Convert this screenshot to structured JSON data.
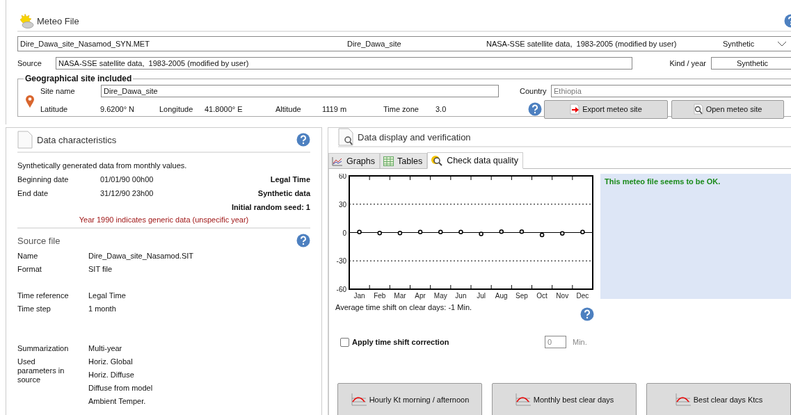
{
  "header": {
    "title": "Meteo File"
  },
  "file_select": {
    "columns": [
      "Dire_Dawa_site_Nasamod_SYN.MET",
      "Dire_Dawa_site",
      "NASA-SSE satellite data,  1983-2005 (modified by user)",
      "Synthetic"
    ]
  },
  "source": {
    "label": "Source",
    "value": "NASA-SSE satellite data,  1983-2005 (modified by user)"
  },
  "kind_year": {
    "label": "Kind / year",
    "value": "Synthetic"
  },
  "site_group": {
    "legend": "Geographical site included",
    "site_name_label": "Site name",
    "site_name": "Dire_Dawa_site",
    "country_label": "Country",
    "country": "Ethiopia",
    "coords": [
      {
        "label": "Latitude",
        "value": "9.6200° N"
      },
      {
        "label": "Longitude",
        "value": "41.8000° E"
      },
      {
        "label": "Altitude",
        "value": "1119 m"
      },
      {
        "label": "Time zone",
        "value": "3.0"
      }
    ],
    "buttons": [
      {
        "label": "Export meteo site",
        "kind": "export"
      },
      {
        "label": "Open meteo site",
        "kind": "open"
      }
    ]
  },
  "data_characteristics": {
    "title": "Data characteristics",
    "intro": "Synthetically generated data from monthly values.",
    "rows": [
      {
        "label": "Beginning date",
        "value": "01/01/90 00h00",
        "note": "Legal Time"
      },
      {
        "label": "End date",
        "value": "31/12/90 23h00",
        "note": "Synthetic data"
      },
      {
        "note": "Initial random seed: 1"
      }
    ],
    "warning": "Year 1990 indicates generic data (unspecific year)"
  },
  "source_file": {
    "title": "Source file",
    "groups": [
      {
        "rows": [
          {
            "label": "Name",
            "values": [
              "Dire_Dawa_site_Nasamod.SIT"
            ]
          },
          {
            "label": "Format",
            "values": [
              "SIT file"
            ]
          }
        ]
      },
      {
        "rows": [
          {
            "label": "Time reference",
            "values": [
              "Legal Time"
            ]
          },
          {
            "label": "Time step",
            "values": [
              "1 month"
            ]
          }
        ]
      },
      {
        "rows": [
          {
            "label": "Summarization",
            "values": [
              "Multi-year"
            ]
          },
          {
            "label": "Used parameters in source",
            "values": [
              "Horiz. Global",
              "Horiz. Diffuse",
              "Diffuse from model",
              "Ambient Temper."
            ]
          }
        ]
      }
    ]
  },
  "display": {
    "title": "Data display and verification",
    "tabs": [
      {
        "label": "Graphs",
        "kind": "graphs",
        "selected": false
      },
      {
        "label": "Tables",
        "kind": "tables",
        "selected": false
      },
      {
        "label": "Check data quality",
        "kind": "quality",
        "selected": true
      }
    ],
    "chart_data": {
      "type": "scatter",
      "categories": [
        "Jan",
        "Feb",
        "Mar",
        "Apr",
        "May",
        "Jun",
        "Jul",
        "Aug",
        "Sep",
        "Oct",
        "Nov",
        "Dec"
      ],
      "series": [
        {
          "color": "#000000",
          "values": [
            0.5,
            -0.5,
            -0.5,
            0.5,
            0.5,
            0.5,
            -1.5,
            1,
            1,
            -2.5,
            -1,
            0.5
          ]
        }
      ],
      "ylim": [
        -60,
        60
      ],
      "yticks": [
        -60,
        -30,
        0,
        30,
        60
      ]
    },
    "average_shift": "Average time shift on clear days: -1 Min.",
    "status": "This meteo file seems to be OK.",
    "correction": {
      "label": "Apply time shift correction",
      "checked": false,
      "disabled": true,
      "value": "0",
      "unit": "Min."
    },
    "buttons": [
      "Hourly Kt morning / afternoon",
      "Monthly best clear days",
      "Best clear days Ktcs"
    ]
  }
}
